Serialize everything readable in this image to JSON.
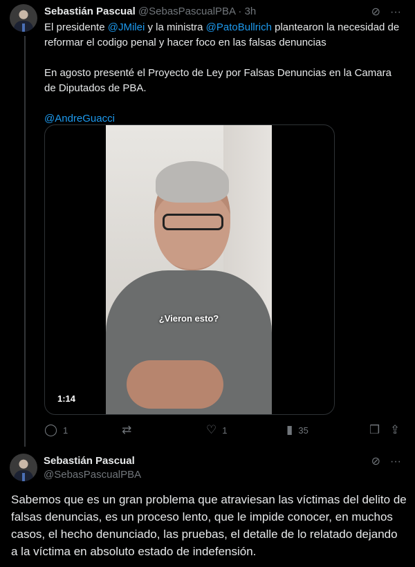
{
  "post1": {
    "author_name": "Sebastián Pascual",
    "author_handle": "@SebasPascualPBA",
    "separator": "·",
    "time": "3h",
    "text": {
      "l1_a": "El presidente ",
      "m1": "@JMilei",
      "l1_b": " y la ministra ",
      "m2": "@PatoBullrich",
      "l1_c": " plantearon la necesidad de reformar el codigo penal y hacer foco en las falsas denuncias",
      "p2": "En agosto presenté el Proyecto de Ley por Falsas Denuncias en la Camara de Diputados de PBA.",
      "m3": "@AndreGuacci"
    },
    "video": {
      "caption": "¿Vieron esto?",
      "duration": "1:14"
    },
    "actions": {
      "replies": "1",
      "reposts": "",
      "likes": "1",
      "views": "35"
    }
  },
  "post2": {
    "author_name": "Sebastián Pascual",
    "author_handle": "@SebasPascualPBA",
    "text": "Sabemos que es un gran problema que atraviesan las víctimas del delito de falsas denuncias, es un proceso lento, que le impide conocer, en muchos casos, el hecho denunciado, las pruebas, el detalle de lo relatado dejando a la víctima en absoluto estado de indefensión."
  },
  "icons": {
    "grok": "grok-icon",
    "more": "more-icon",
    "reply": "reply-icon",
    "repost": "repost-icon",
    "like": "like-icon",
    "views": "views-icon",
    "bookmark": "bookmark-icon",
    "share": "share-icon"
  },
  "colors": {
    "background": "#000000",
    "text": "#e7e9ea",
    "muted": "#71767b",
    "link": "#1d9bf0"
  }
}
